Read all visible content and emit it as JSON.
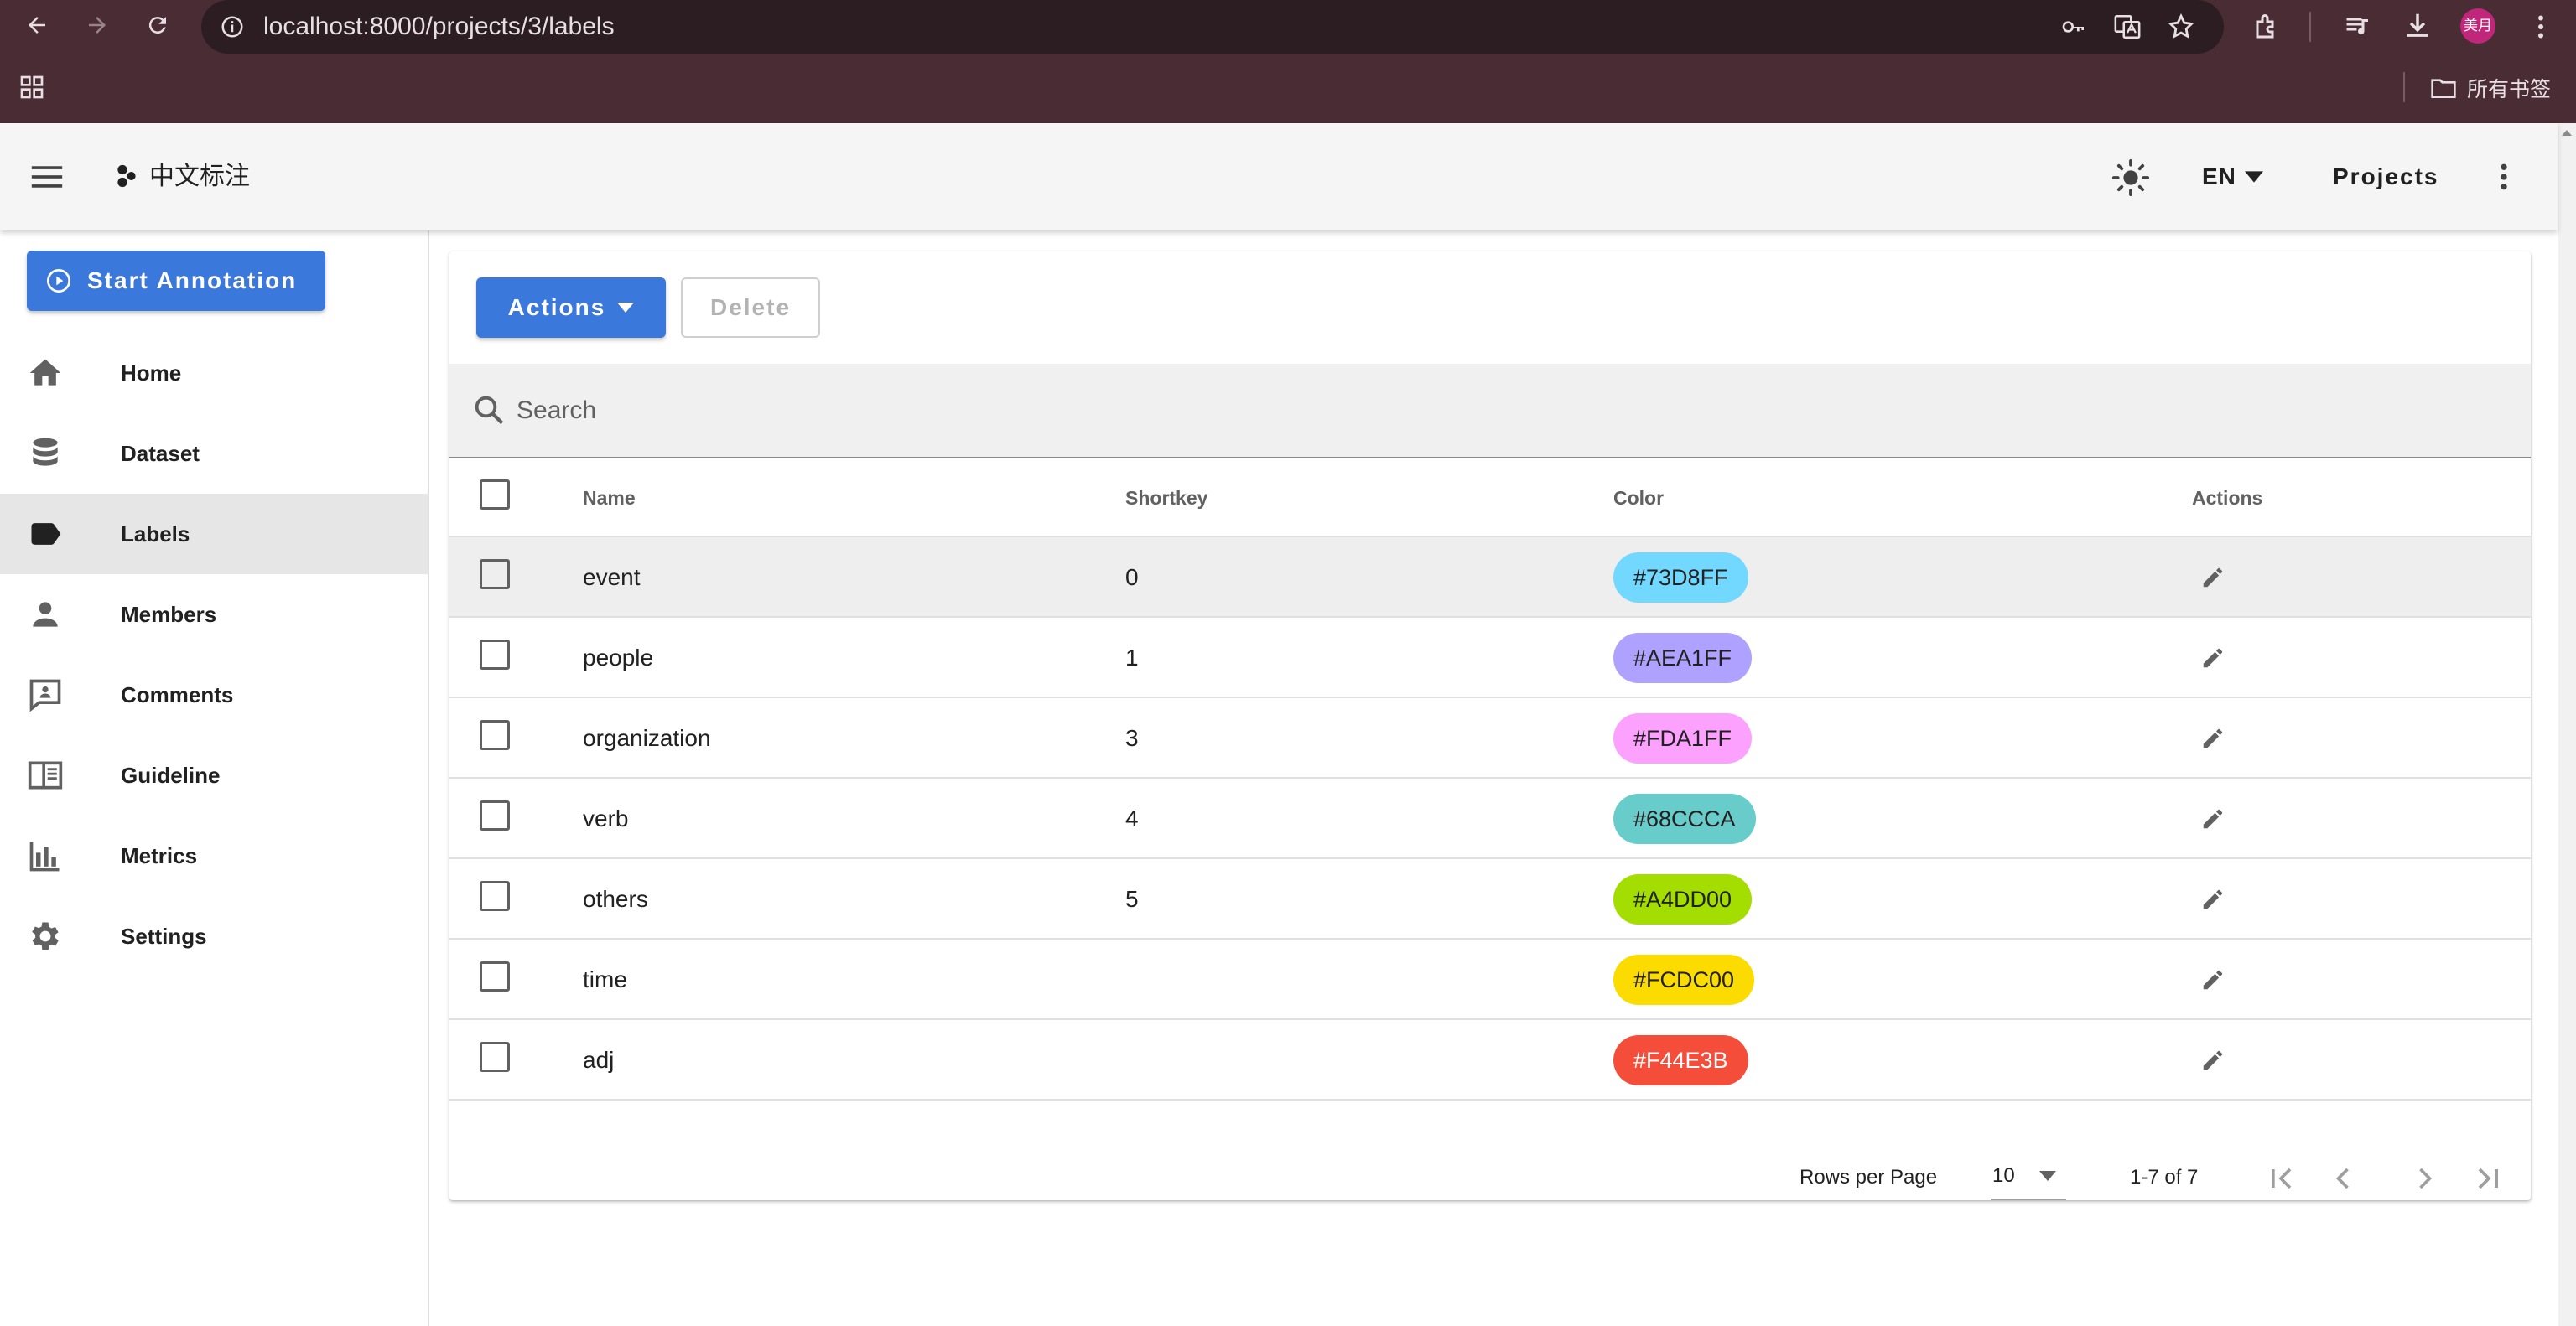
{
  "browser": {
    "url": "localhost:8000/projects/3/labels",
    "profile_initials": "美月",
    "bookmarks_label": "所有书签"
  },
  "appbar": {
    "title": "中文标注",
    "language": "EN",
    "projects_label": "Projects"
  },
  "sidebar": {
    "start_label": "Start Annotation",
    "items": [
      {
        "label": "Home",
        "icon": "home-icon",
        "active": false
      },
      {
        "label": "Dataset",
        "icon": "database-icon",
        "active": false
      },
      {
        "label": "Labels",
        "icon": "label-icon",
        "active": true
      },
      {
        "label": "Members",
        "icon": "person-icon",
        "active": false
      },
      {
        "label": "Comments",
        "icon": "comment-icon",
        "active": false
      },
      {
        "label": "Guideline",
        "icon": "book-icon",
        "active": false
      },
      {
        "label": "Metrics",
        "icon": "bar-chart-icon",
        "active": false
      },
      {
        "label": "Settings",
        "icon": "gear-icon",
        "active": false
      }
    ]
  },
  "toolbar": {
    "actions_label": "Actions",
    "delete_label": "Delete"
  },
  "search": {
    "placeholder": "Search",
    "value": ""
  },
  "table": {
    "headers": {
      "name": "Name",
      "shortkey": "Shortkey",
      "color": "Color",
      "actions": "Actions"
    },
    "rows": [
      {
        "name": "event",
        "shortkey": "0",
        "color": "#73D8FF",
        "text_color": "#212121"
      },
      {
        "name": "people",
        "shortkey": "1",
        "color": "#AEA1FF",
        "text_color": "#212121"
      },
      {
        "name": "organization",
        "shortkey": "3",
        "color": "#FDA1FF",
        "text_color": "#212121"
      },
      {
        "name": "verb",
        "shortkey": "4",
        "color": "#68CCCA",
        "text_color": "#212121"
      },
      {
        "name": "others",
        "shortkey": "5",
        "color": "#A4DD00",
        "text_color": "#212121"
      },
      {
        "name": "time",
        "shortkey": "",
        "color": "#FCDC00",
        "text_color": "#212121"
      },
      {
        "name": "adj",
        "shortkey": "",
        "color": "#F44E3B",
        "text_color": "#ffffff"
      }
    ]
  },
  "pagination": {
    "rows_per_page_label": "Rows per Page",
    "rows_per_page": "10",
    "range": "1-7 of 7"
  },
  "colors": {
    "primary": "#3b78dc",
    "chrome": "#4a2c35"
  }
}
